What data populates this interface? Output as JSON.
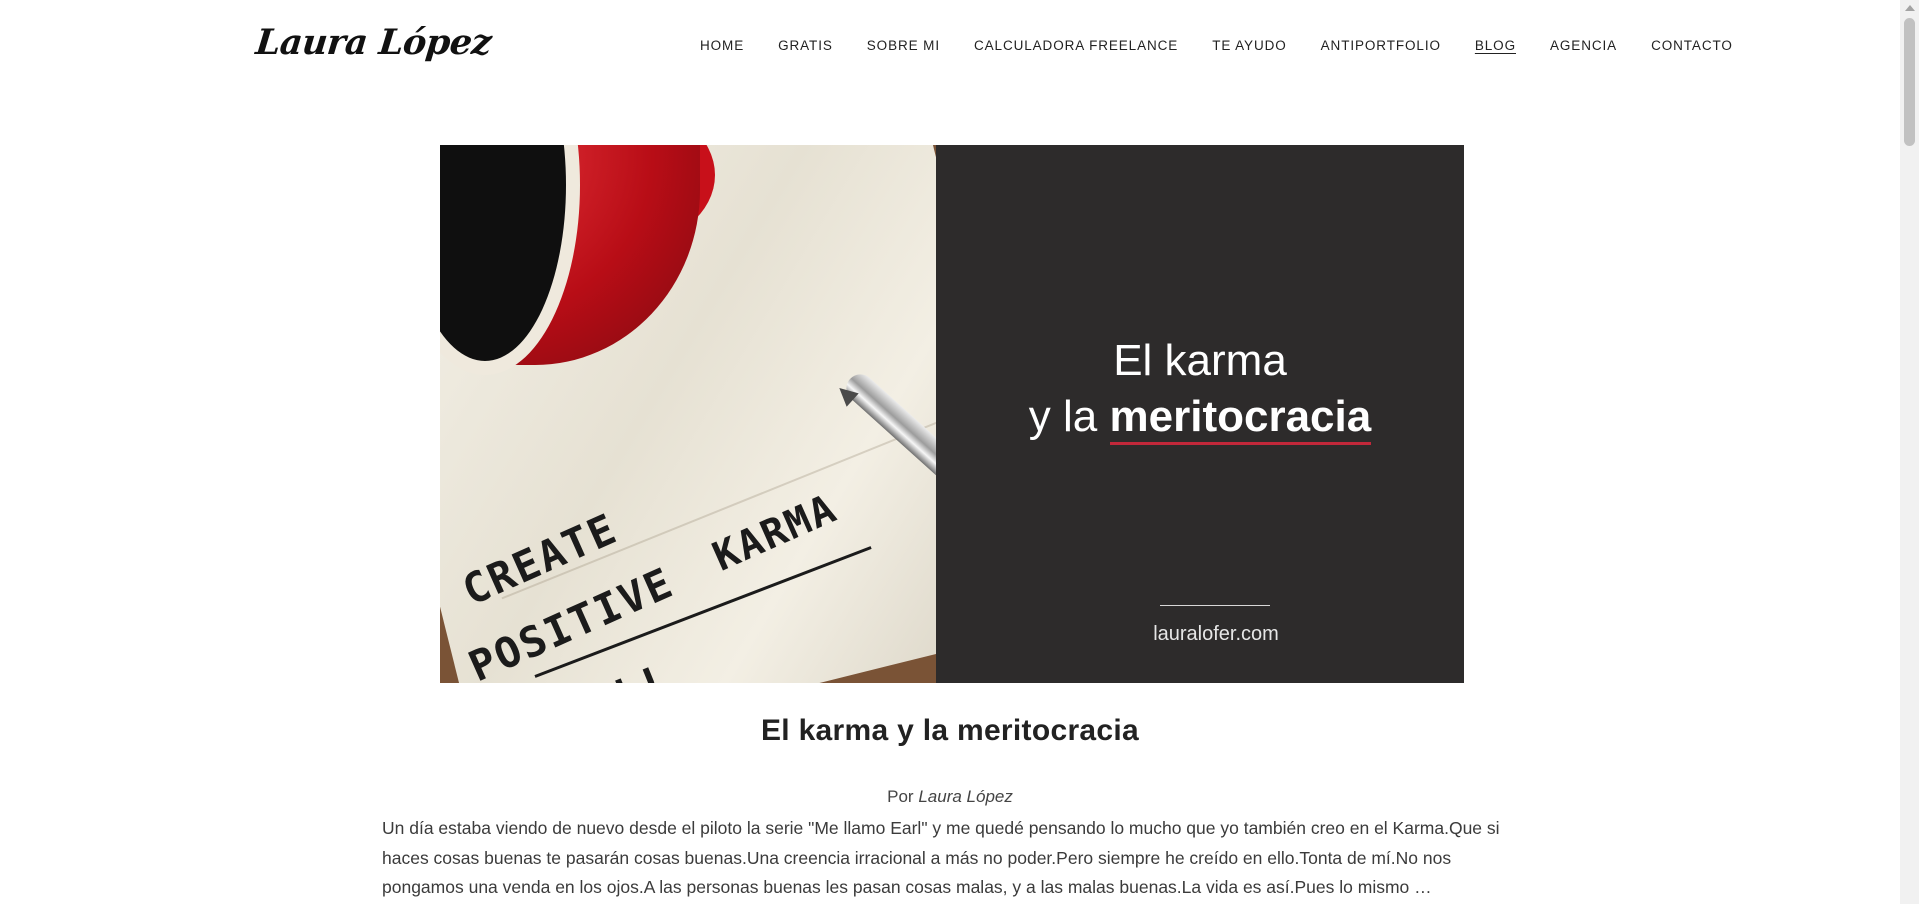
{
  "site": {
    "logo": "Laura López"
  },
  "nav": {
    "items": [
      {
        "label": "HOME"
      },
      {
        "label": "GRATIS"
      },
      {
        "label": "SOBRE MI"
      },
      {
        "label": "CALCULADORA FREELANCE"
      },
      {
        "label": "TE AYUDO"
      },
      {
        "label": "ANTIPORTFOLIO"
      },
      {
        "label": "BLOG",
        "active": true
      },
      {
        "label": "AGENCIA"
      },
      {
        "label": "CONTACTO"
      }
    ]
  },
  "hero": {
    "handwriting": {
      "line1": "CREATE",
      "line2": "POSITIVE",
      "karma": "KARMA",
      "line3": "NOW !!"
    },
    "title_line1": "El karma",
    "title_line2_pre": "y la ",
    "title_line2_strong": "meritocracia",
    "site": "lauralofer.com",
    "colors": {
      "panel": "#2d2b2b",
      "accent_underline": "#c2283a"
    }
  },
  "post": {
    "title": "El karma y la meritocracia",
    "byline_prefix": "Por ",
    "author": "Laura López",
    "excerpt": "Un día estaba viendo de nuevo desde el piloto la serie \"Me llamo Earl\" y me quedé pensando lo mucho que yo también creo en el Karma.Que si haces cosas buenas te pasarán cosas buenas.Una creencia irracional a más no poder.Pero siempre he creído en ello.Tonta de mí.No nos pongamos una venda en los ojos.A las personas buenas les pasan cosas malas, y a las malas buenas.La vida es así.Pues lo mismo …"
  }
}
